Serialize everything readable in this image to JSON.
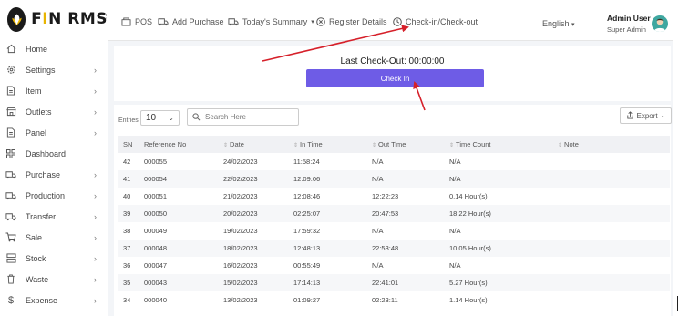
{
  "brand": {
    "name_prefix": "F",
    "name_i": "I",
    "name_suffix": "N RMS"
  },
  "sidebar": {
    "items": [
      {
        "label": "Home",
        "icon": "home-icon",
        "has_chevron": false
      },
      {
        "label": "Settings",
        "icon": "gear-icon",
        "has_chevron": true
      },
      {
        "label": "Item",
        "icon": "document-icon",
        "has_chevron": true
      },
      {
        "label": "Outlets",
        "icon": "store-icon",
        "has_chevron": true
      },
      {
        "label": "Panel",
        "icon": "document-icon",
        "has_chevron": true
      },
      {
        "label": "Dashboard",
        "icon": "grid-icon",
        "has_chevron": false
      },
      {
        "label": "Purchase",
        "icon": "truck-icon",
        "has_chevron": true
      },
      {
        "label": "Production",
        "icon": "truck-icon",
        "has_chevron": true
      },
      {
        "label": "Transfer",
        "icon": "truck-icon",
        "has_chevron": true
      },
      {
        "label": "Sale",
        "icon": "cart-icon",
        "has_chevron": true
      },
      {
        "label": "Stock",
        "icon": "stack-icon",
        "has_chevron": true
      },
      {
        "label": "Waste",
        "icon": "trash-icon",
        "has_chevron": true
      },
      {
        "label": "Expense",
        "icon": "dollar-icon",
        "has_chevron": true
      }
    ]
  },
  "topbar": {
    "pos": "POS",
    "add_purchase": "Add Purchase",
    "todays_summary": "Today's Summary",
    "register_details": "Register Details",
    "checkin_checkout": "Check-in/Check-out",
    "language": "English",
    "user_name": "Admin User",
    "user_role": "Super Admin"
  },
  "checkin": {
    "last_checkout": "Last Check-Out: 00:00:00",
    "button": "Check In"
  },
  "table_controls": {
    "entries_label": "Entries",
    "entries_value": "10",
    "search_placeholder": "Search Here",
    "export": "Export"
  },
  "table": {
    "headers": [
      "SN",
      "Reference No",
      "Date",
      "In Time",
      "Out Time",
      "Time Count",
      "Note"
    ],
    "rows": [
      [
        "42",
        "000055",
        "24/02/2023",
        "11:58:24",
        "N/A",
        "N/A",
        ""
      ],
      [
        "41",
        "000054",
        "22/02/2023",
        "12:09:06",
        "N/A",
        "N/A",
        ""
      ],
      [
        "40",
        "000051",
        "21/02/2023",
        "12:08:46",
        "12:22:23",
        "0.14 Hour(s)",
        ""
      ],
      [
        "39",
        "000050",
        "20/02/2023",
        "02:25:07",
        "20:47:53",
        "18.22 Hour(s)",
        ""
      ],
      [
        "38",
        "000049",
        "19/02/2023",
        "17:59:32",
        "N/A",
        "N/A",
        ""
      ],
      [
        "37",
        "000048",
        "18/02/2023",
        "12:48:13",
        "22:53:48",
        "10.05 Hour(s)",
        ""
      ],
      [
        "36",
        "000047",
        "16/02/2023",
        "00:55:49",
        "N/A",
        "N/A",
        ""
      ],
      [
        "35",
        "000043",
        "15/02/2023",
        "17:14:13",
        "22:41:01",
        "5.27 Hour(s)",
        ""
      ],
      [
        "34",
        "000040",
        "13/02/2023",
        "01:09:27",
        "02:23:11",
        "1.14 Hour(s)",
        ""
      ]
    ]
  },
  "colors": {
    "accent": "#6e5ce6",
    "annotation": "#d6202a",
    "brand_i": "#e8b400"
  }
}
